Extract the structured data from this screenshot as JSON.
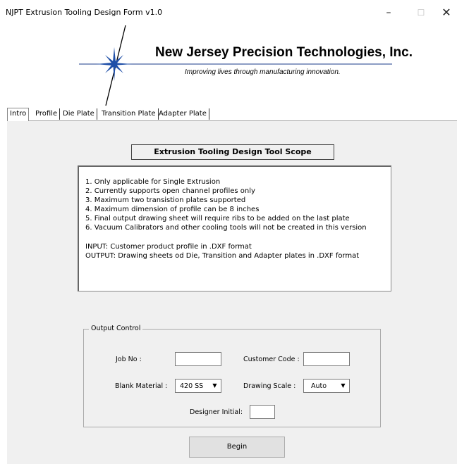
{
  "window": {
    "title": "NJPT Extrusion Tooling Design Form v1.0",
    "minimize_icon": "minimize-icon",
    "maximize_icon": "maximize-icon",
    "close_icon": "close-icon"
  },
  "header": {
    "company": "New Jersey Precision Technologies, Inc.",
    "tagline": "Improving lives through manufacturing innovation."
  },
  "tabs": [
    {
      "label": "Intro",
      "active": true
    },
    {
      "label": "Profile"
    },
    {
      "label": "Die Plate"
    },
    {
      "label": "Transition Plate"
    },
    {
      "label": "Adapter Plate"
    }
  ],
  "intro": {
    "scope_title": "Extrusion Tooling Design Tool Scope",
    "scope_lines": [
      "1. Only applicable for Single Extrusion",
      "2. Currently supports open channel profiles only",
      "3. Maximum two transistion plates supported",
      "4. Maximum dimension of profile can be 8 inches",
      "5. Final output drawing sheet will require ribs to be added on the last plate",
      "6. Vacuum Calibrators and other cooling tools will not be created in this version",
      "INPUT: Customer product profile in .DXF format",
      "OUTPUT: Drawing sheets od Die, Transition and Adapter plates in .DXF format"
    ]
  },
  "output_control": {
    "legend": "Output Control",
    "job_no_label": "Job No :",
    "job_no_value": "",
    "customer_code_label": "Customer Code :",
    "customer_code_value": "",
    "blank_material_label": "Blank Material :",
    "blank_material_value": "420 SS",
    "drawing_scale_label": "Drawing Scale :",
    "drawing_scale_value": "Auto",
    "designer_initial_label": "Designer Initial:",
    "designer_initial_value": ""
  },
  "begin_label": "Begin"
}
